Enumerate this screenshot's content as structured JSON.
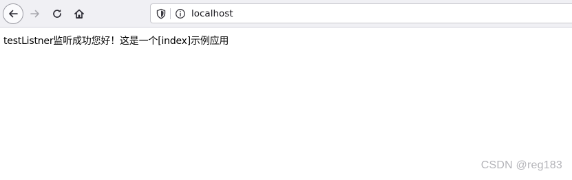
{
  "browser": {
    "address": "localhost",
    "icons": {
      "back": "back-arrow-icon",
      "forward": "forward-arrow-icon",
      "reload": "reload-icon",
      "home": "home-icon",
      "tracking": "shield-icon",
      "site_info": "info-icon"
    },
    "forward_enabled": false
  },
  "page": {
    "body_text": "testListner监听成功您好！这是一个[index]示例应用"
  },
  "watermark": "CSDN @reg183",
  "colors": {
    "toolbar_bg": "#f0f0f4",
    "urlbar_bg": "#ffffff",
    "page_bg": "#ffffff",
    "text": "#000000",
    "watermark": "#b3b3b8",
    "disabled_icon": "#a8a8ae"
  }
}
